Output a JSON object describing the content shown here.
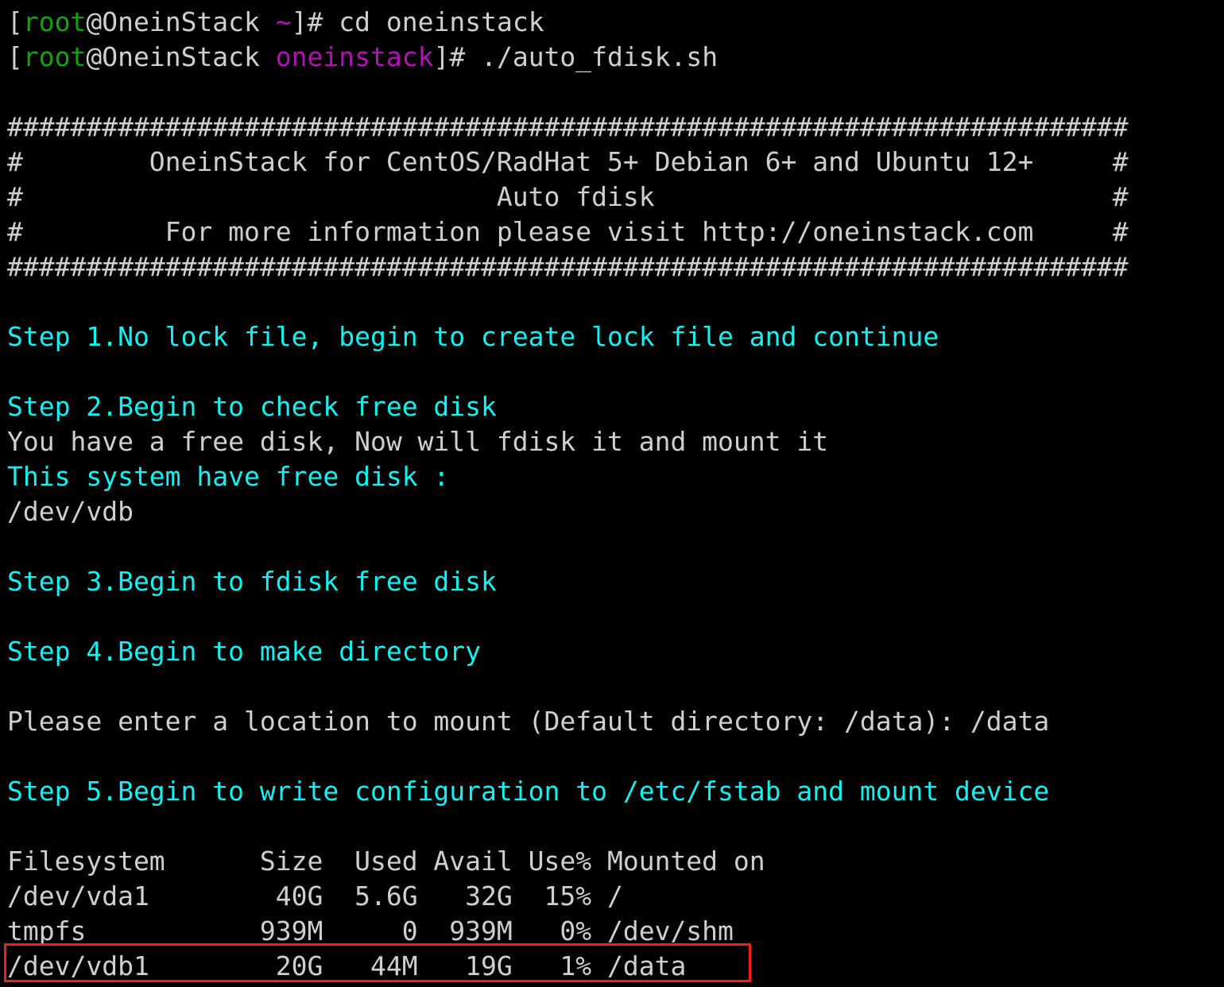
{
  "terminal": {
    "background_color": "#000000",
    "foreground_color": "#cfcfcf",
    "colors": {
      "cyan": "#15f0f0",
      "green": "#12a312",
      "magenta": "#b312b3",
      "white": "#cfcfcf",
      "highlight_red": "#ee2211"
    }
  },
  "prompt1": {
    "bracket_open": "[",
    "user": "root",
    "at": "@",
    "host": "OneinStack",
    "space": " ",
    "path": "~",
    "bracket_close": "]# ",
    "command": "cd oneinstack"
  },
  "prompt2": {
    "bracket_open": "[",
    "user": "root",
    "at": "@",
    "host": "OneinStack",
    "space": " ",
    "path": "oneinstack",
    "bracket_close": "]# ",
    "command": "./auto_fdisk.sh"
  },
  "banner": {
    "rule_top": "#######################################################################",
    "line1": "#        OneinStack for CentOS/RadHat 5+ Debian 6+ and Ubuntu 12+     #",
    "line2": "#                              Auto fdisk                             #",
    "line3": "#         For more information please visit http://oneinstack.com     #",
    "rule_bottom": "#######################################################################"
  },
  "steps": {
    "step1": "Step 1.No lock file, begin to create lock file and continue",
    "step2": "Step 2.Begin to check free disk",
    "step2_msg": "You have a free disk, Now will fdisk it and mount it",
    "step2_have": "This system have free disk :",
    "step2_device": "/dev/vdb",
    "step3": "Step 3.Begin to fdisk free disk",
    "step4": "Step 4.Begin to make directory",
    "mount_prompt": "Please enter a location to mount (Default directory: /data): /data",
    "step5": "Step 5.Begin to write configuration to /etc/fstab and mount device"
  },
  "df_table": {
    "header": {
      "filesystem": "Filesystem",
      "size": "Size",
      "used": "Used",
      "avail": "Avail",
      "use_pct": "Use%",
      "mounted_on": "Mounted on"
    },
    "header_line": "Filesystem      Size  Used Avail Use% Mounted on",
    "rows": [
      {
        "line": "/dev/vda1        40G  5.6G   32G  15% /",
        "filesystem": "/dev/vda1",
        "size": "40G",
        "used": "5.6G",
        "avail": "32G",
        "use_pct": "15%",
        "mounted_on": "/",
        "highlighted": false
      },
      {
        "line": "tmpfs           939M     0  939M   0% /dev/shm",
        "filesystem": "tmpfs",
        "size": "939M",
        "used": "0",
        "avail": "939M",
        "use_pct": "0%",
        "mounted_on": "/dev/shm",
        "highlighted": false
      },
      {
        "line": "/dev/vdb1        20G   44M   19G   1% /data",
        "filesystem": "/dev/vdb1",
        "size": "20G",
        "used": "44M",
        "avail": "19G",
        "use_pct": "1%",
        "mounted_on": "/data",
        "highlighted": true
      }
    ]
  }
}
